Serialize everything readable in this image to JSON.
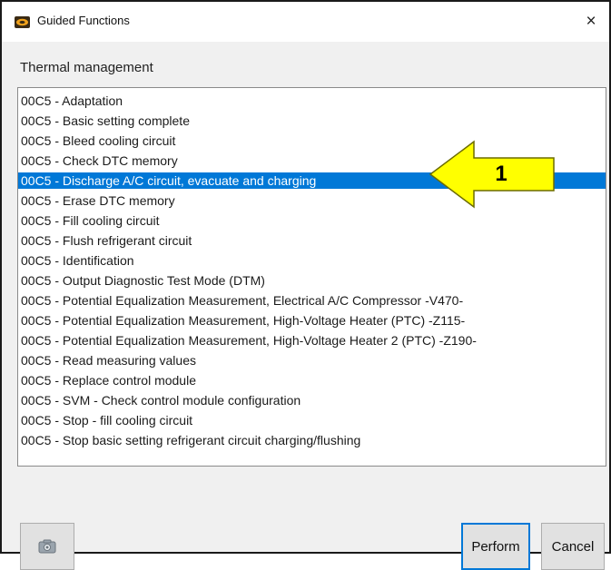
{
  "window": {
    "title": "Guided Functions",
    "close_glyph": "×"
  },
  "section": {
    "label": "Thermal management"
  },
  "functions": {
    "selected_index": 4,
    "items": [
      "00C5 - Adaptation",
      "00C5 - Basic setting complete",
      "00C5 - Bleed cooling circuit",
      "00C5 - Check DTC memory",
      "00C5 - Discharge A/C circuit, evacuate and charging",
      "00C5 - Erase DTC memory",
      "00C5 - Fill cooling circuit",
      "00C5 - Flush refrigerant circuit",
      "00C5 - Identification",
      "00C5 - Output Diagnostic Test Mode (DTM)",
      "00C5 - Potential Equalization Measurement, Electrical A/C Compressor -V470-",
      "00C5 - Potential Equalization Measurement, High-Voltage Heater (PTC) -Z115-",
      "00C5 - Potential Equalization Measurement, High-Voltage Heater 2 (PTC) -Z190-",
      "00C5 - Read measuring values",
      "00C5 - Replace control module",
      "00C5 - SVM - Check control module configuration",
      "00C5 - Stop - fill cooling circuit",
      "00C5 - Stop basic setting refrigerant circuit charging/flushing"
    ]
  },
  "callout": {
    "number": "1",
    "fill_color": "#ffff00",
    "stroke_color": "#6b6b00"
  },
  "buttons": {
    "camera_icon": "camera-icon",
    "perform_label": "Perform",
    "cancel_label": "Cancel"
  },
  "colors": {
    "selection": "#0078d7",
    "window_bg": "#f0f0f0"
  }
}
